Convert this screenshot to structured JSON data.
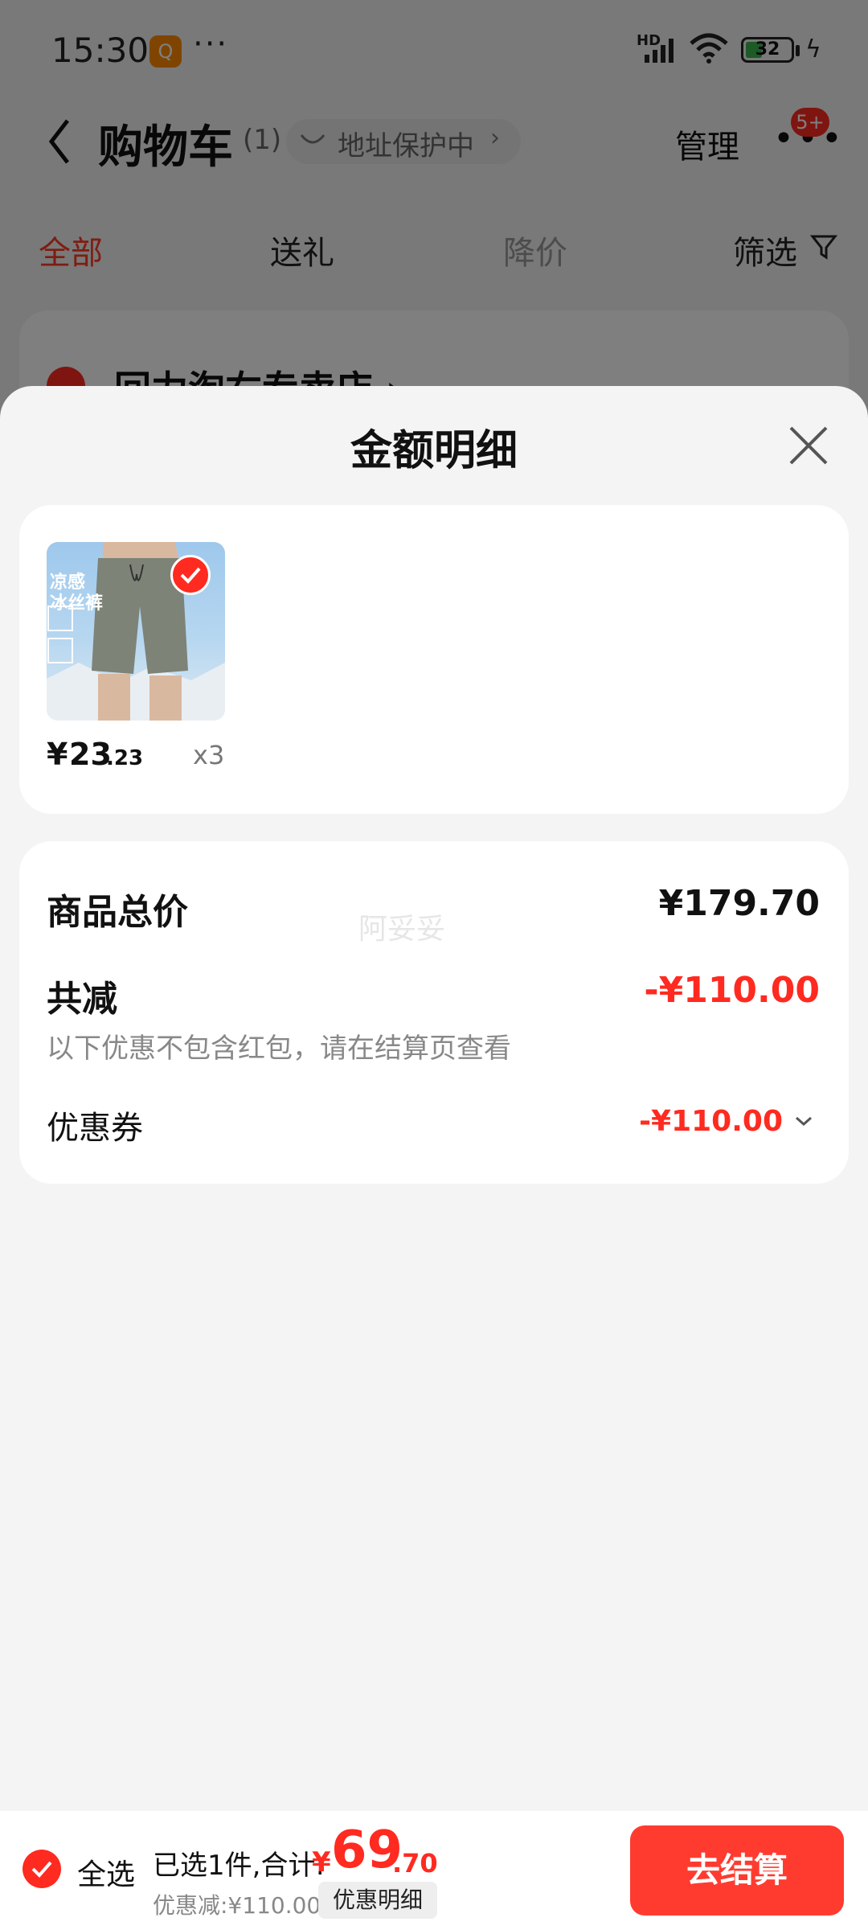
{
  "status_bar": {
    "time": "15:30",
    "app_icon_text": "Q",
    "more": "···",
    "network": "HD",
    "battery": "32"
  },
  "nav": {
    "title": "购物车",
    "count": "(1)",
    "address_protect": "地址保护中",
    "address_chevron": "›",
    "manage": "管理",
    "more_dots": "•••",
    "badge": "5+"
  },
  "tabs": [
    {
      "label": "全部",
      "state": "active"
    },
    {
      "label": "送礼",
      "state": "normal"
    },
    {
      "label": "降价",
      "state": "muted"
    },
    {
      "label": "筛选",
      "state": "normal"
    }
  ],
  "store": {
    "name": "回力淘右专卖店 ›"
  },
  "sheet": {
    "title": "金额明细",
    "product": {
      "thumb_text_1": "凉感",
      "thumb_text_2": "冰丝裤",
      "price_symbol": "¥",
      "price_int": "23",
      "price_dec": ".23",
      "quantity": "x3"
    },
    "summary": {
      "total_label": "商品总价",
      "total_value": "¥179.70",
      "discount_label": "共减",
      "discount_value": "-¥110.00",
      "note": "以下优惠不包含红包，请在结算页查看",
      "coupon_label": "优惠券",
      "coupon_value": "-¥110.00",
      "watermark": "阿妥妥"
    }
  },
  "bottom_bar": {
    "select_all": "全选",
    "total_prefix": "已选1件,合计:",
    "total_symbol": "¥",
    "total_int": "69",
    "total_dec": ".70",
    "discount_text": "优惠减:¥110.00",
    "detail_chip": "优惠明细",
    "checkout": "去结算"
  },
  "colors": {
    "accent": "#ff2a20",
    "sheet_bg": "#f4f4f4",
    "card_bg": "#ffffff"
  }
}
